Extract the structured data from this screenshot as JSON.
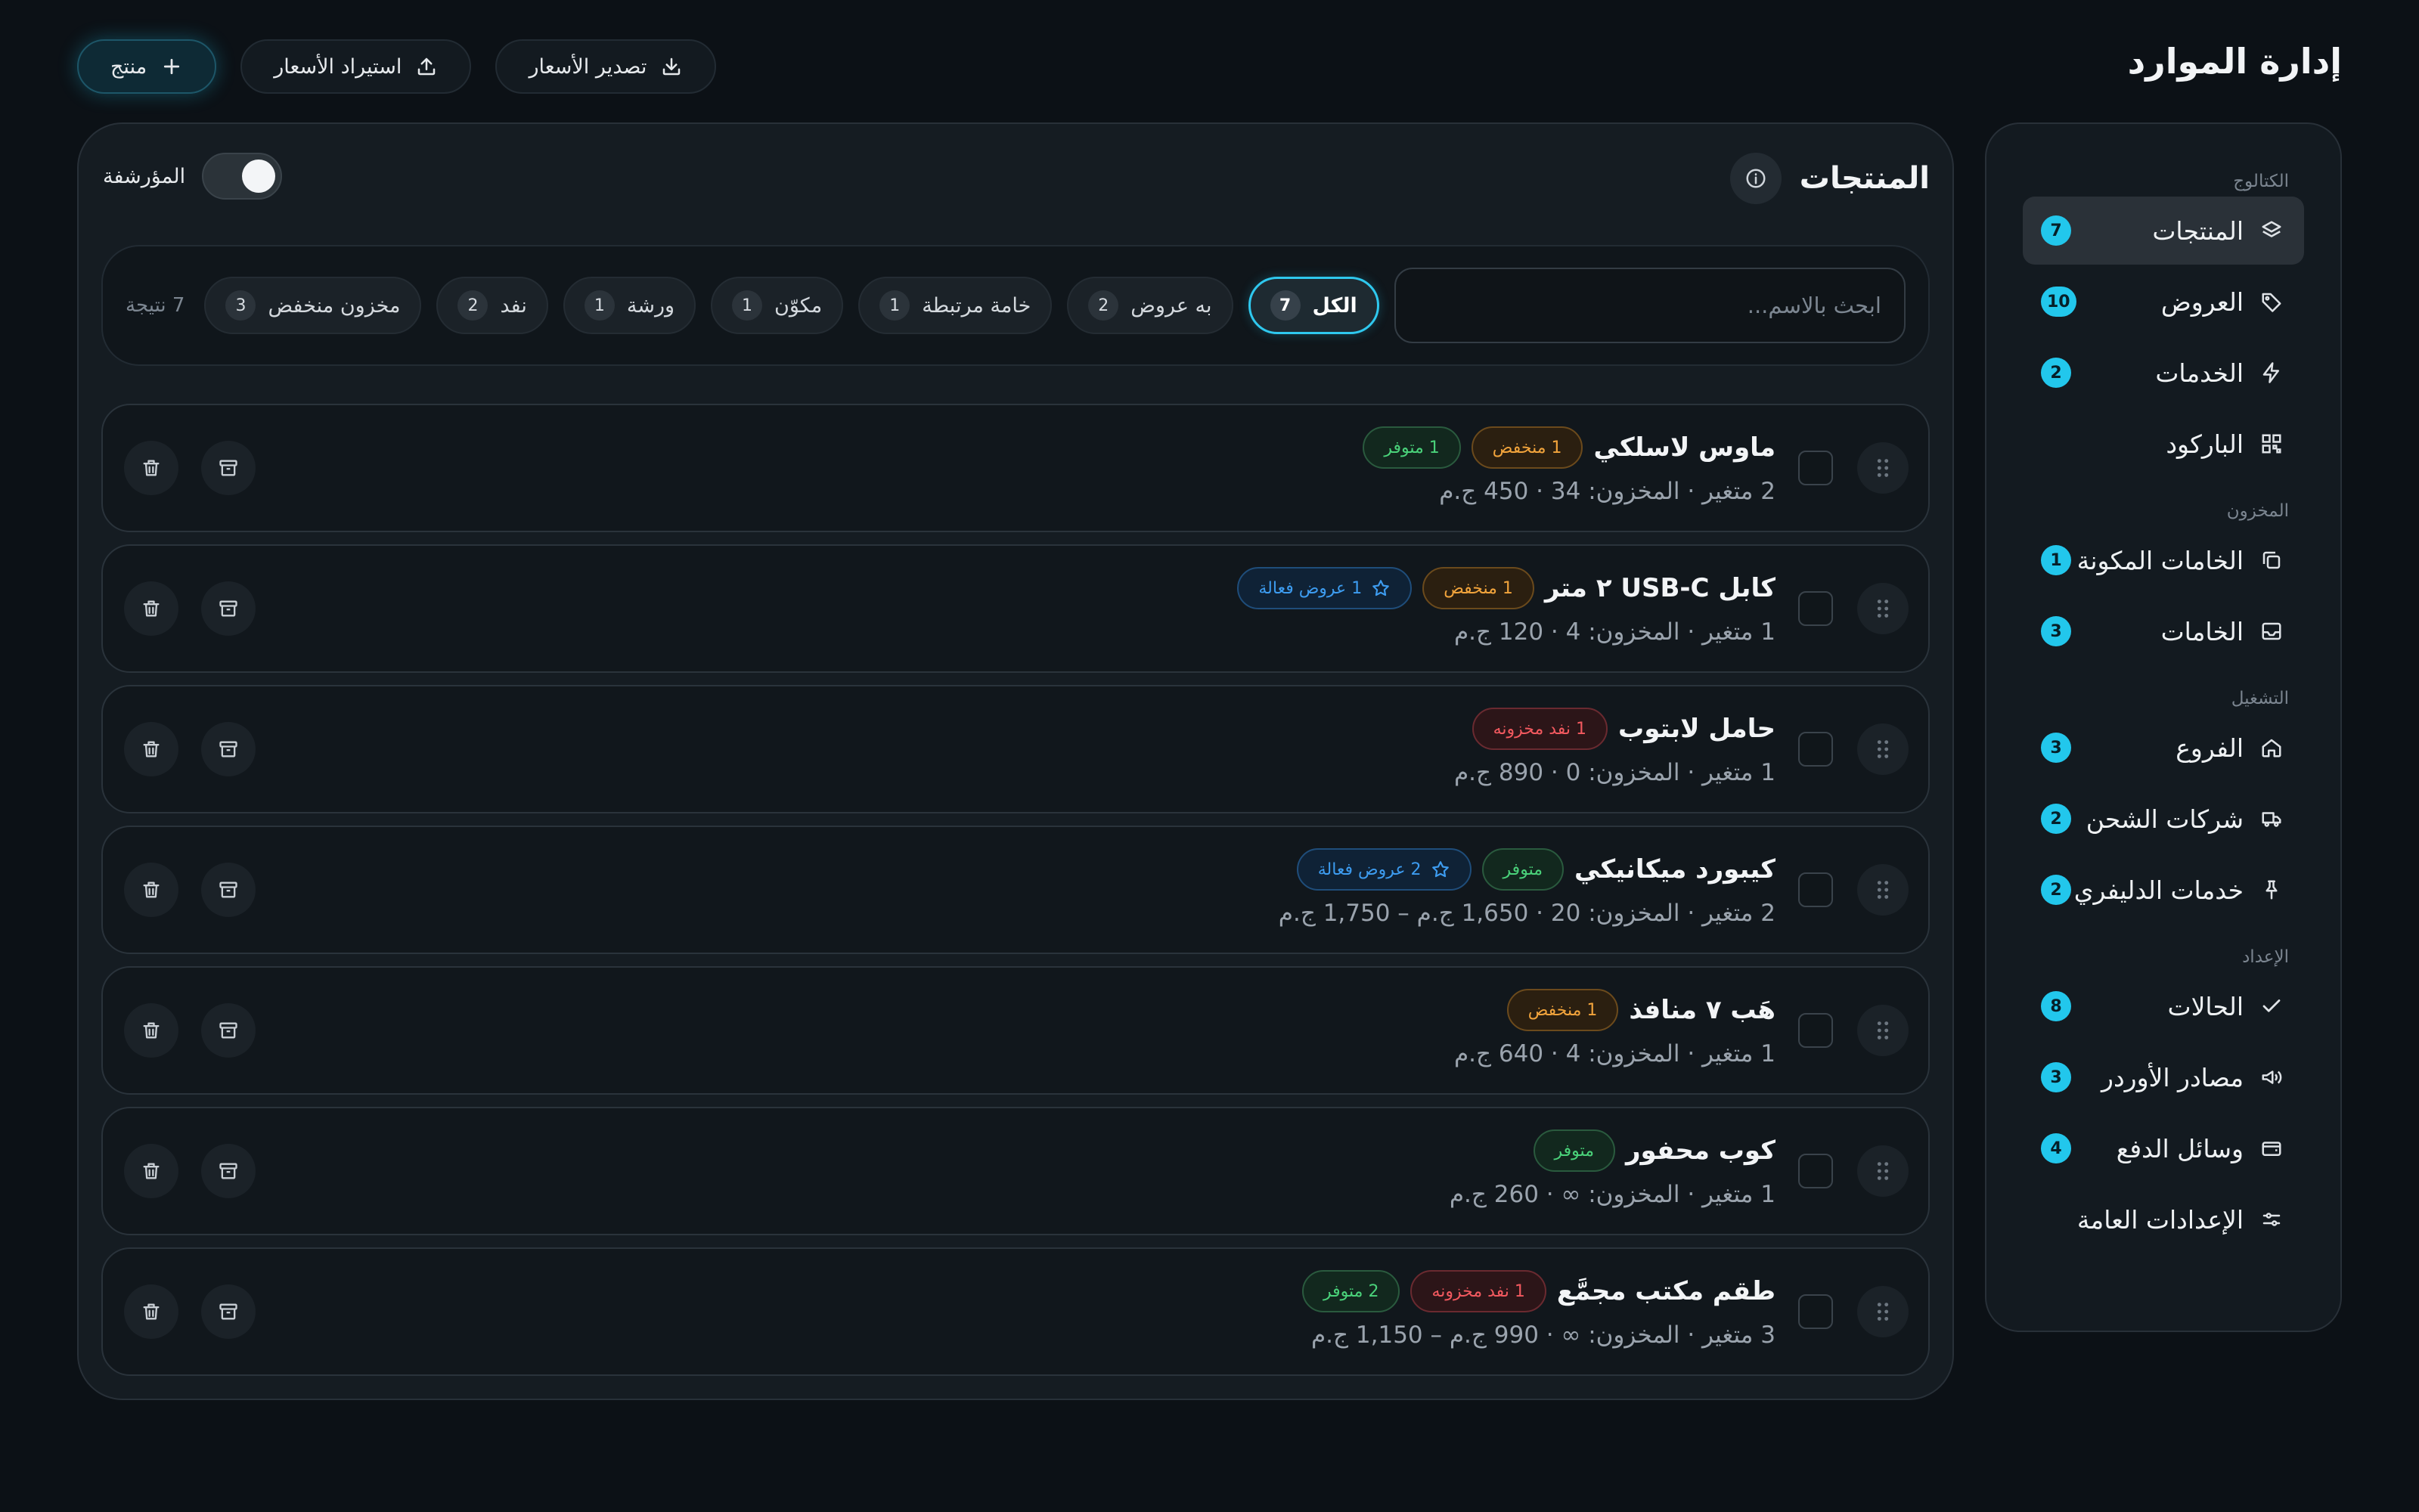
{
  "app": {
    "title": "إدارة الموارد"
  },
  "header": {
    "add_product_label": "منتج",
    "import_prices_label": "استيراد الأسعار",
    "export_prices_label": "تصدير الأسعار"
  },
  "sidebar": {
    "sections": {
      "catalog": "الكتالوج",
      "inventory": "المخزون",
      "operations": "التشغيل",
      "setup": "الإعداد"
    },
    "items": {
      "products": {
        "label": "المنتجات",
        "count": "7"
      },
      "offers": {
        "label": "العروض",
        "count": "10"
      },
      "services": {
        "label": "الخدمات",
        "count": "2"
      },
      "barcode": {
        "label": "الباركود"
      },
      "components": {
        "label": "الخامات المكونة",
        "count": "1"
      },
      "materials": {
        "label": "الخامات",
        "count": "3"
      },
      "branches": {
        "label": "الفروع",
        "count": "3"
      },
      "shipping": {
        "label": "شركات الشحن",
        "count": "2"
      },
      "delivery": {
        "label": "خدمات الدليفري",
        "count": "2"
      },
      "statuses": {
        "label": "الحالات",
        "count": "8"
      },
      "order_sources": {
        "label": "مصادر الأوردر",
        "count": "3"
      },
      "payment_methods": {
        "label": "وسائل الدفع",
        "count": "4"
      },
      "general_settings": {
        "label": "الإعدادات العامة"
      }
    }
  },
  "main": {
    "title": "المنتجات",
    "archived_label": "المؤرشفة",
    "search_placeholder": "ابحث بالاسم...",
    "filters": {
      "all": {
        "label": "الكل",
        "count": "7"
      },
      "with_offers": {
        "label": "به عروض",
        "count": "2"
      },
      "linked_material": {
        "label": "خامة مرتبطة",
        "count": "1"
      },
      "component": {
        "label": "مكوّن",
        "count": "1"
      },
      "workshop": {
        "label": "ورشة",
        "count": "1"
      },
      "out": {
        "label": "نفد",
        "count": "2"
      },
      "low_stock": {
        "label": "مخزون منخفض",
        "count": "3"
      }
    },
    "result_count": "7 نتيجة"
  },
  "products": [
    {
      "name": "ماوس لاسلكي",
      "meta": "2 متغير · المخزون: 34 · 450 ج.م",
      "badges": [
        "1 منخفض",
        "1 متوفر"
      ]
    },
    {
      "name": "كابل USB-C ٢ متر",
      "meta": "1 متغير · المخزون: 4 · 120 ج.م",
      "badges": [
        "1 منخفض",
        "1 عروض فعالة"
      ]
    },
    {
      "name": "حامل لابتوب",
      "meta": "1 متغير · المخزون: 0 · 890 ج.م",
      "badges": [
        "1 نفد مخزونه"
      ]
    },
    {
      "name": "كيبورد ميكانيكي",
      "meta": "2 متغير · المخزون: 20 · 1,650 ج.م – 1,750 ج.م",
      "badges": [
        "متوفر",
        "2 عروض فعالة"
      ]
    },
    {
      "name": "هَب ٧ منافذ",
      "meta": "1 متغير · المخزون: 4 · 640 ج.م",
      "badges": [
        "1 منخفض"
      ]
    },
    {
      "name": "كوب محفور",
      "meta": "1 متغير · المخزون: ∞ · 260 ج.م",
      "badges": [
        "متوفر"
      ]
    },
    {
      "name": "طقم مكتب مجمَّع",
      "meta": "3 متغير · المخزون: ∞ · 990 ج.م – 1,150 ج.م",
      "badges": [
        "1 نفد مخزونه",
        "2 متوفر"
      ]
    }
  ],
  "icons": {
    "add": "plus-icon",
    "import": "upload-icon",
    "export": "download-icon",
    "info": "info-icon",
    "drag": "grip-icon",
    "archive": "archive-icon",
    "delete": "trash-icon",
    "offer": "star-icon"
  },
  "colors": {
    "accent": "#22c7ec",
    "in_stock": "#4ad27a",
    "low": "#f2a43c",
    "out": "#f2595f",
    "offers": "#3d9cf0"
  }
}
